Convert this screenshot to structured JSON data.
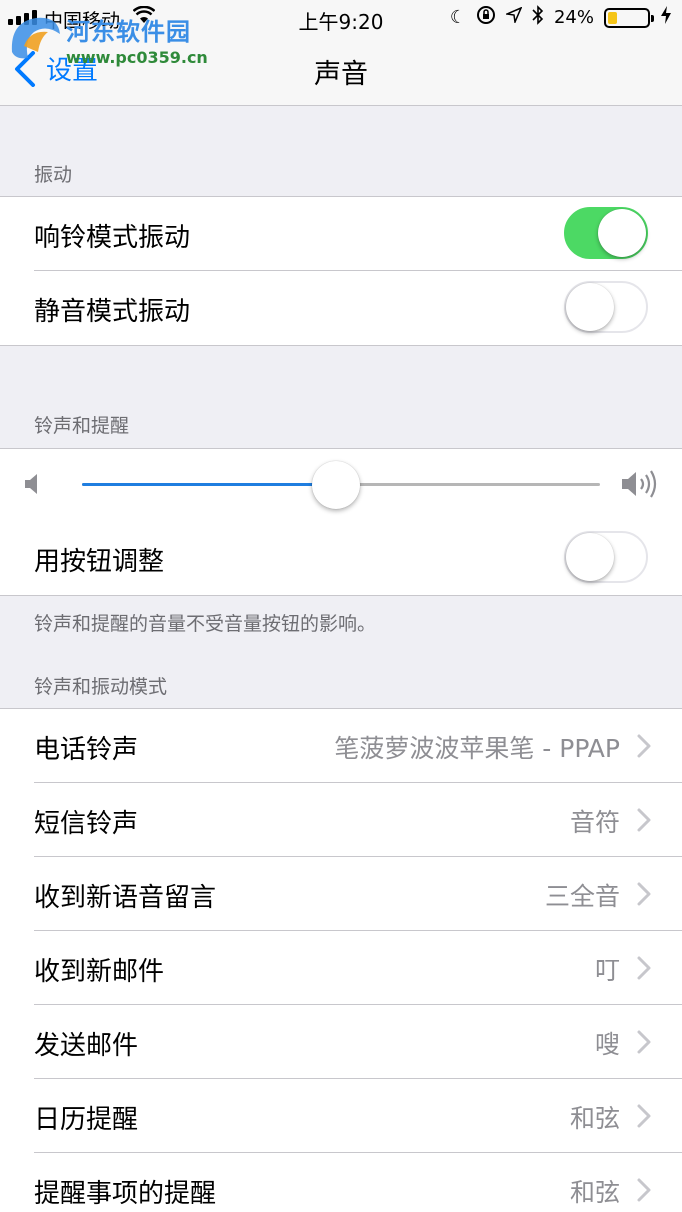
{
  "status_bar": {
    "carrier": "中国移动",
    "time": "上午9:20",
    "battery": "24%",
    "battery_level": 0.24
  },
  "watermark": {
    "title": "河东软件园",
    "url": "www.pc0359.cn"
  },
  "nav": {
    "back_label": "设置",
    "title": "声音"
  },
  "vibration": {
    "header": "振动",
    "rows": [
      {
        "label": "响铃模式振动",
        "on": true
      },
      {
        "label": "静音模式振动",
        "on": false
      }
    ]
  },
  "ringer": {
    "header": "铃声和提醒",
    "volume_level": 0.49,
    "button_adjust": {
      "label": "用按钮调整",
      "on": false
    },
    "footnote": "铃声和提醒的音量不受音量按钮的影响。"
  },
  "patterns": {
    "header": "铃声和振动模式",
    "rows": [
      {
        "label": "电话铃声",
        "value": "笔菠萝波波苹果笔 - PPAP"
      },
      {
        "label": "短信铃声",
        "value": "音符"
      },
      {
        "label": "收到新语音留言",
        "value": "三全音"
      },
      {
        "label": "收到新邮件",
        "value": "叮"
      },
      {
        "label": "发送邮件",
        "value": "嗖"
      },
      {
        "label": "日历提醒",
        "value": "和弦"
      },
      {
        "label": "提醒事项的提醒",
        "value": "和弦"
      }
    ]
  },
  "colors": {
    "accent": "#007aff",
    "toggle_on": "#4cd964",
    "slider_fill": "#1f7ee0",
    "battery_fill": "#f5c518"
  }
}
